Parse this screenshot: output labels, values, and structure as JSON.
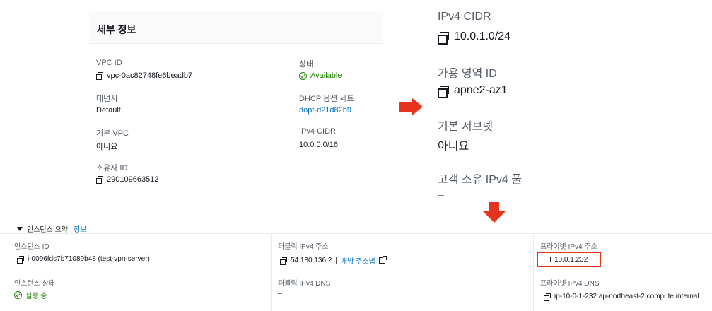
{
  "vpc_details": {
    "title": "세부 정보",
    "vpc_id": {
      "label": "VPC ID",
      "value": "vpc-0ac82748fe6beadb7"
    },
    "tenancy": {
      "label": "테넌시",
      "value": "Default"
    },
    "default_vpc": {
      "label": "기본 VPC",
      "value": "아니요"
    },
    "owner_id": {
      "label": "소유자 ID",
      "value": "290109663512"
    },
    "state": {
      "label": "상태",
      "value": "Available"
    },
    "dhcp": {
      "label": "DHCP 옵션 세트",
      "value": "dopt-d21d82b9"
    },
    "ipv4_cidr": {
      "label": "IPv4 CIDR",
      "value": "10.0.0.0/16"
    }
  },
  "subnet_details": {
    "ipv4_cidr": {
      "label": "IPv4 CIDR",
      "value": "10.0.1.0/24"
    },
    "az_id": {
      "label": "가용 영역 ID",
      "value": "apne2-az1"
    },
    "default_subnet": {
      "label": "기본 서브넷",
      "value": "아니요"
    },
    "customer_pool": {
      "label": "고객 소유 IPv4 풀",
      "value": "–"
    }
  },
  "instance_summary": {
    "title": "인스턴스 요약",
    "info_link": "정보",
    "instance_id": {
      "label": "인스턴스 ID",
      "value": "i-0096fdc7b71089b48 (test-vpn-server)"
    },
    "public_ip": {
      "label": "퍼블릭 IPv4 주소",
      "value": "54.180.136.2",
      "sep": "|",
      "link": "개방 주소법"
    },
    "private_ip": {
      "label": "프라이빗 IPv4 주소",
      "value": "10.0.1.232"
    },
    "instance_state": {
      "label": "인스턴스 상태",
      "value": "실행 중"
    },
    "public_dns": {
      "label": "퍼블릭 IPv4 DNS",
      "value": "–"
    },
    "private_dns": {
      "label": "프라이빗 IPv4 DNS",
      "value": "ip-10-0-1-232.ap-northeast-2.compute.internal"
    }
  },
  "colors": {
    "accent_link": "#0073bb",
    "success": "#1d8102",
    "annotation_red": "#e8331c"
  },
  "icons": [
    "copy-icon",
    "check-circle-icon",
    "external-link-icon",
    "caret-down-icon",
    "arrow-right-icon",
    "arrow-down-icon"
  ]
}
